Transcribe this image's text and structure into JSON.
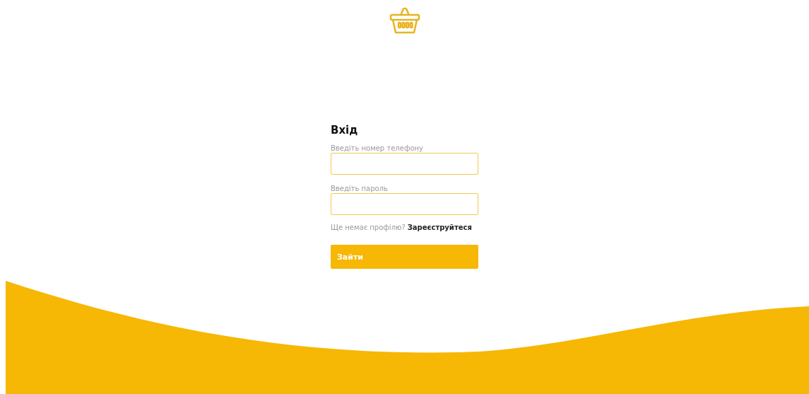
{
  "title": "Вхід",
  "fields": [
    {
      "label": "Введіть номер телефону"
    },
    {
      "label": "Введіть пароль"
    }
  ],
  "signup": {
    "prompt": "Ще немає профілю?",
    "link": "Зареєструйтеся"
  },
  "submit": "Зайти"
}
